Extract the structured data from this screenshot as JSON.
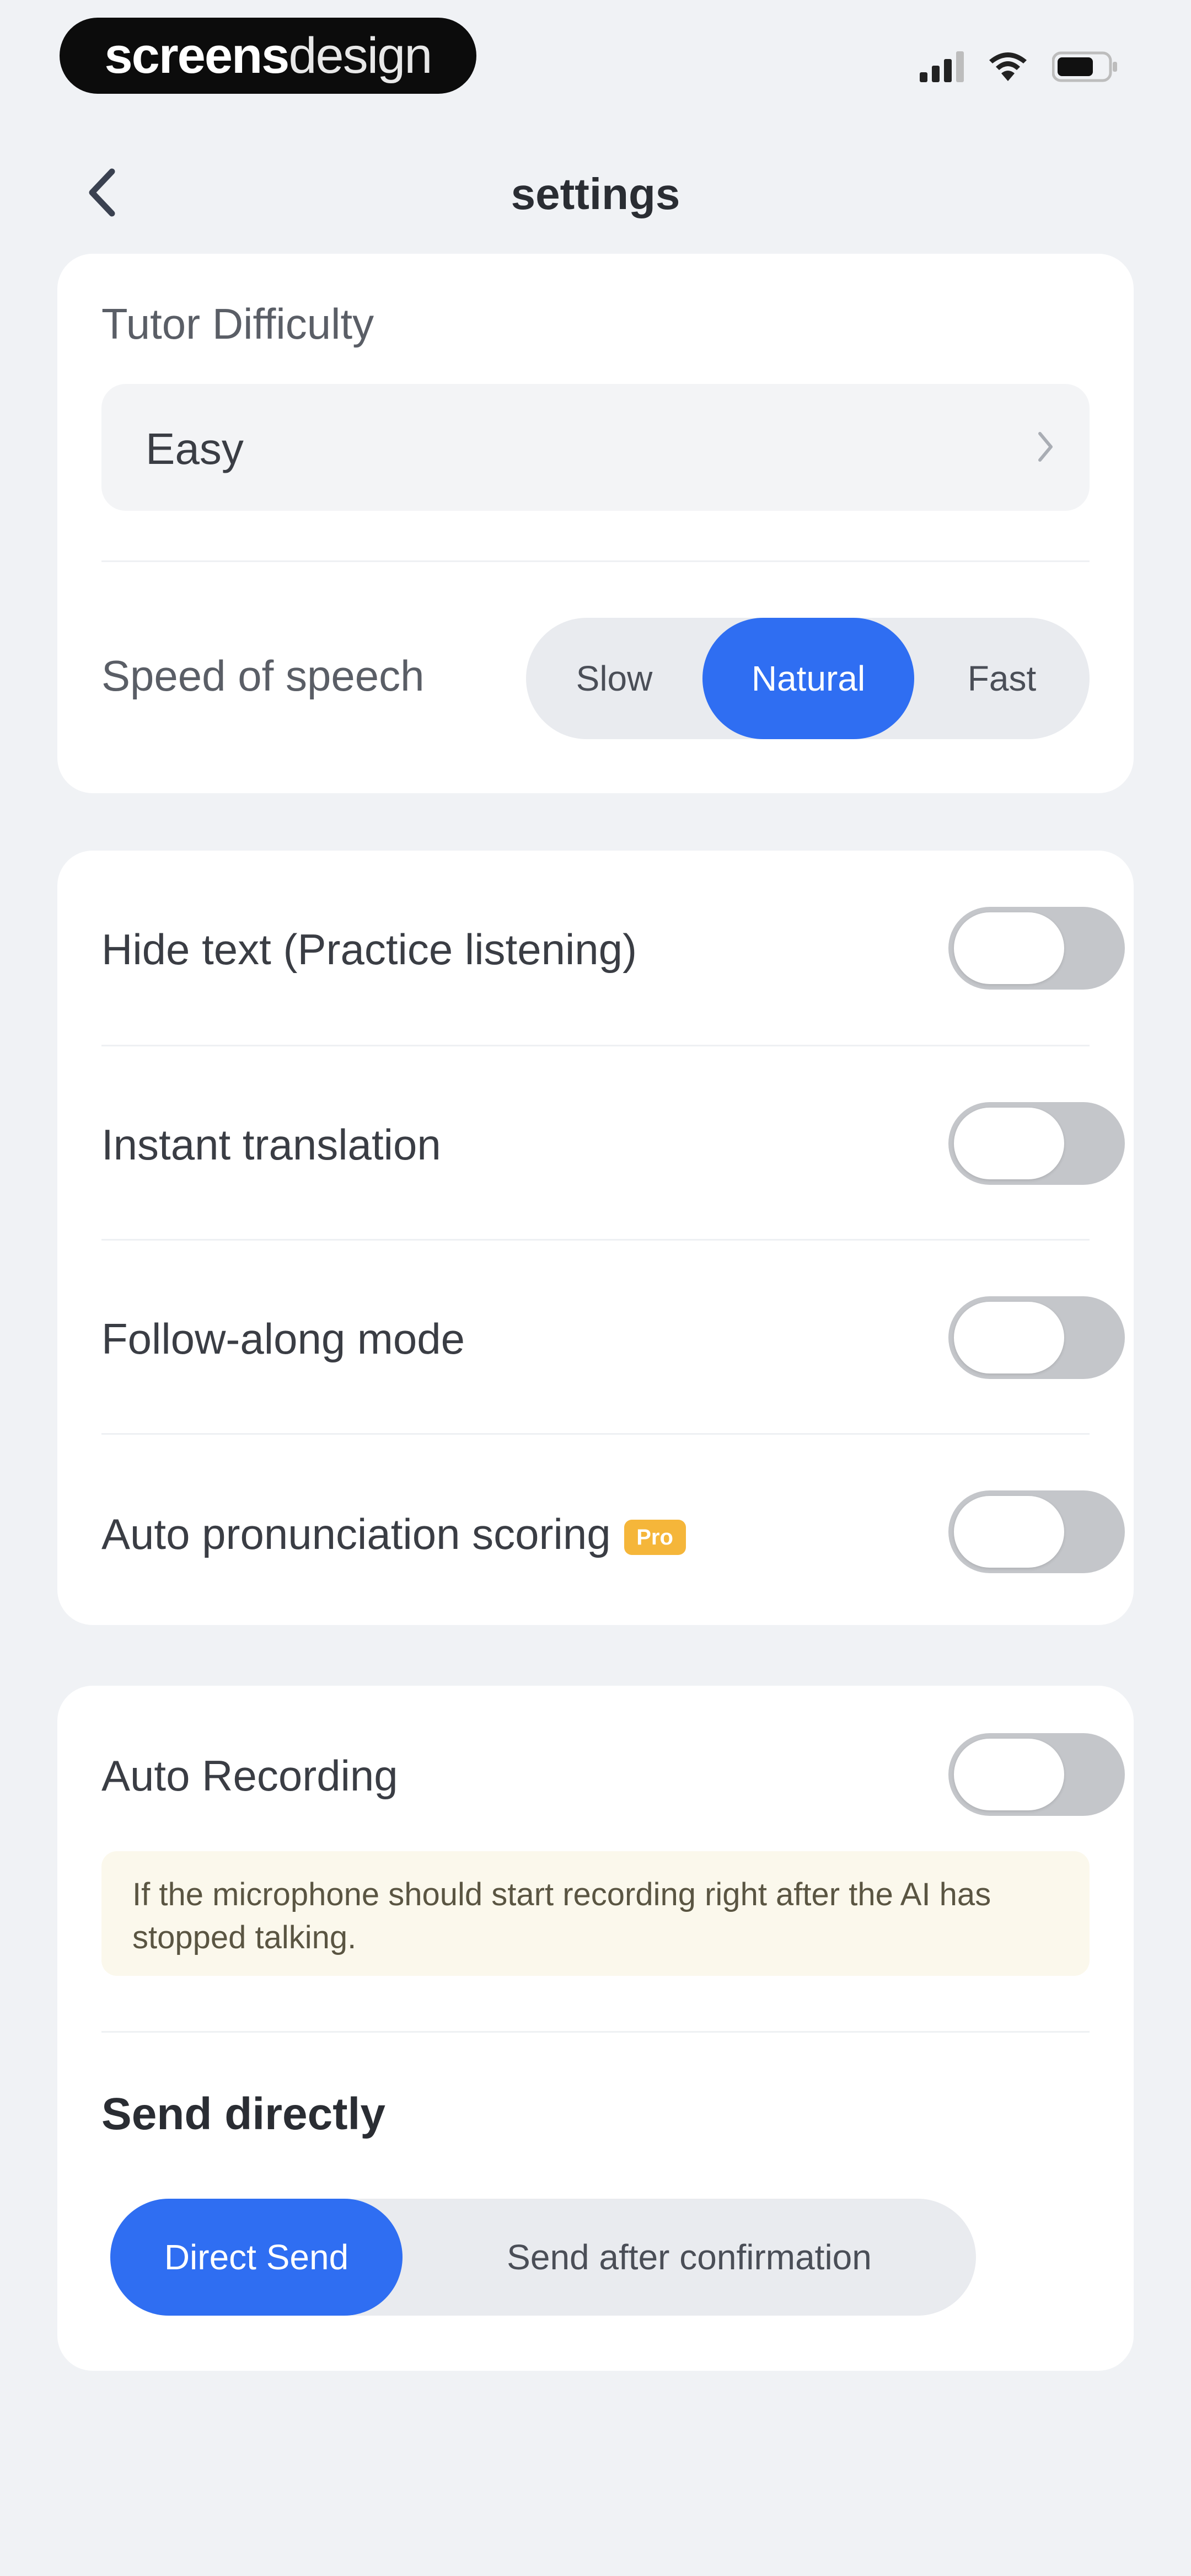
{
  "status_bar": {
    "brand_bold": "screens",
    "brand_light": "design"
  },
  "nav": {
    "title": "settings"
  },
  "tutor": {
    "label": "Tutor Difficulty",
    "value": "Easy"
  },
  "speech_speed": {
    "label": "Speed of speech",
    "options": [
      "Slow",
      "Natural",
      "Fast"
    ],
    "selected": "Natural"
  },
  "toggles": [
    {
      "label": "Hide text (Practice listening)",
      "on": false
    },
    {
      "label": "Instant translation",
      "on": false
    },
    {
      "label": "Follow-along mode",
      "on": false
    },
    {
      "label": "Auto pronunciation scoring",
      "on": false,
      "badge": "Pro"
    }
  ],
  "auto_recording": {
    "label": "Auto Recording",
    "on": false,
    "hint": "If the microphone should start recording right after the AI has stopped talking."
  },
  "send": {
    "title": "Send directly",
    "options": [
      "Direct Send",
      "Send after confirmation"
    ],
    "selected": "Direct Send"
  },
  "colors": {
    "accent": "#2f6ef2",
    "background": "#f0f2f5",
    "card": "#ffffff",
    "toggle_off": "#c4c6ca",
    "badge": "#f5b63a",
    "hint_bg": "#fbf8ec"
  }
}
